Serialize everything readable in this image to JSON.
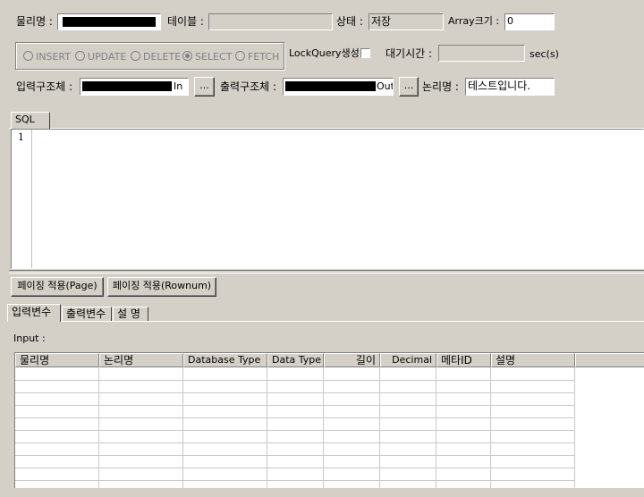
{
  "row1": {
    "physical_name_label": "물리명 :",
    "physical_name_value": "",
    "table_label": "테이블 :",
    "table_value": "",
    "status_label": "상태 :",
    "status_value": "저장",
    "array_size_label": "Array크기 :",
    "array_size_value": "0"
  },
  "modes": {
    "options": [
      "INSERT",
      "UPDATE",
      "DELETE",
      "SELECT",
      "FETCH"
    ],
    "selected": "SELECT"
  },
  "lockquery_label": "LockQuery생성",
  "wait_time_label": "대기시간 :",
  "wait_time_value": "",
  "wait_time_unit": "sec(s)",
  "row3": {
    "input_struct_label": "입력구조체 :",
    "input_suffix": "In",
    "browse_label": "...",
    "output_struct_label": "출력구조체 :",
    "output_suffix": "Out",
    "logical_name_label": "논리명 :",
    "logical_name_value": "테스트입니다."
  },
  "sql_tab": "SQL",
  "editor": {
    "line_number": "1"
  },
  "buttons": {
    "paging_page": "페이징 적용(Page)",
    "paging_rownum": "페이징 적용(Rownum)"
  },
  "bottom_tabs": [
    "입력변수",
    "출력변수",
    "설 명"
  ],
  "input_label": "Input :",
  "grid": {
    "columns": [
      "물리명",
      "논리명",
      "Database Type",
      "Data Type",
      "길이",
      "Decimal",
      "메타ID",
      "설명",
      ""
    ]
  }
}
